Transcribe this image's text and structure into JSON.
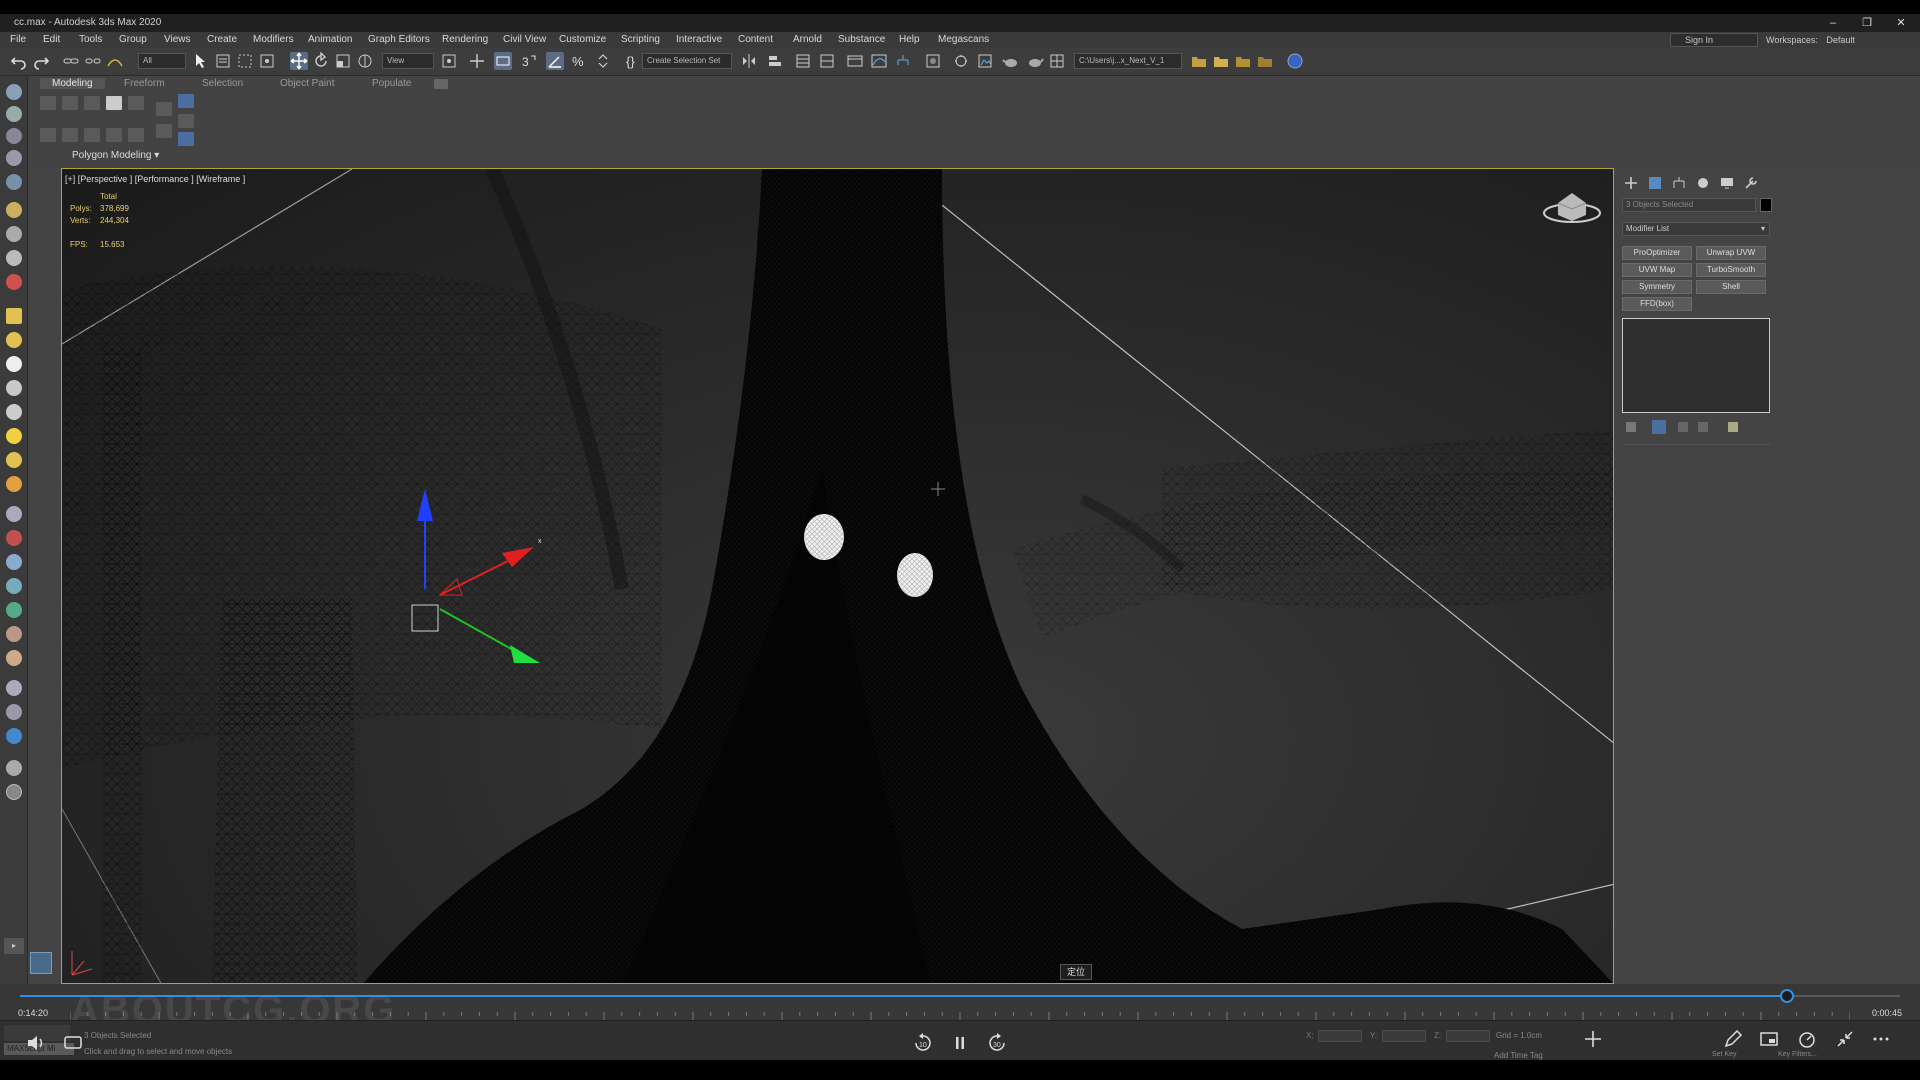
{
  "window": {
    "title": "cc.max - Autodesk 3ds Max 2020",
    "minimize": "–",
    "restore": "❐",
    "close": "✕"
  },
  "menu": {
    "items": [
      "File",
      "Edit",
      "Tools",
      "Group",
      "Views",
      "Create",
      "Modifiers",
      "Animation",
      "Graph Editors",
      "Rendering",
      "Civil View",
      "Customize",
      "Scripting",
      "Interactive",
      "Content",
      "Arnold",
      "Substance",
      "Help",
      "Megascans"
    ],
    "sign_in": "Sign In",
    "workspaces_label": "Workspaces:",
    "workspaces_value": "Default"
  },
  "toolbar": {
    "filter": "All",
    "ref_coord": "View",
    "create_selection_set": "Create Selection Set",
    "path": "C:\\Users\\j...x_Next_V_1"
  },
  "ribbon": {
    "tabs": [
      "Modeling",
      "Freeform",
      "Selection",
      "Object Paint",
      "Populate"
    ],
    "panel_label": "Polygon Modeling"
  },
  "viewport": {
    "label": "[+] [Perspective ] [Performance ] [Wireframe ]",
    "stats": {
      "total_label": "Total",
      "polys_label": "Polys:",
      "polys_value": "378,699",
      "verts_label": "Verts:",
      "verts_value": "244,304",
      "fps_label": "FPS:",
      "fps_value": "15.653"
    }
  },
  "command_panel": {
    "selection": "3 Objects Selected",
    "modifier_list": "Modifier List",
    "modifier_buttons": [
      "ProOptimizer",
      "Unwrap UVW",
      "UVW Map",
      "TurboSmooth",
      "Symmetry",
      "Shell",
      "FFD(box)"
    ]
  },
  "timeline": {
    "current": "0:14:20",
    "end": "0:00:45",
    "progress": 0.94
  },
  "status": {
    "maxscript": "MAXScript Mi",
    "selected": "3 Objects Selected",
    "prompt": "Click and drag to select and move objects",
    "x_label": "X:",
    "y_label": "Y:",
    "z_label": "Z:",
    "grid": "Grid = 1.0cm",
    "add_time_tag": "Add Time Tag",
    "set_key": "Set Key",
    "key_filters": "Key Filters..."
  },
  "player": {
    "rewind": "10",
    "forward": "30"
  },
  "tooltip": "定位",
  "watermark": "ABOUTCG.ORG",
  "colors": {
    "accent": "#2f8ee8",
    "viewport_border": "#b8a040",
    "gizmo_x": "#e02020",
    "gizmo_y": "#20c020",
    "gizmo_z": "#2040ff"
  }
}
